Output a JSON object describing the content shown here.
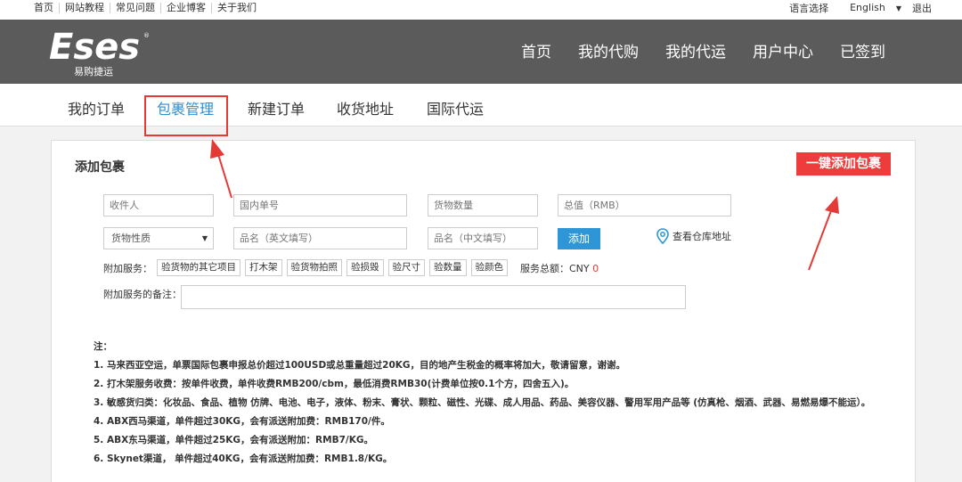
{
  "topbar": {
    "links": [
      "首页",
      "网站教程",
      "常见问题",
      "企业博客",
      "关于我们"
    ],
    "language_label": "语言选择",
    "language_value": "English",
    "logout": "退出"
  },
  "header": {
    "logo_text": "Eses",
    "logo_tagline": "易购捷运",
    "nav": [
      "首页",
      "我的代购",
      "我的代运",
      "用户中心",
      "已签到"
    ]
  },
  "tabs": [
    "我的订单",
    "包裹管理",
    "新建订单",
    "收货地址",
    "国际代运"
  ],
  "panel": {
    "title": "添加包裹",
    "quick_add": "一键添加包裹",
    "fields": {
      "recipient": "收件人",
      "domestic_no": "国内单号",
      "quantity": "货物数量",
      "value": "总值（RMB）",
      "nature": "货物性质",
      "name_en": "品名（英文填写）",
      "name_cn": "品名（中文填写）"
    },
    "add_button": "添加",
    "warehouse_link": "查看仓库地址",
    "services_label": "附加服务：",
    "services": [
      "验货物的其它项目",
      "打木架",
      "验货物拍照",
      "验损毁",
      "验尺寸",
      "验数量",
      "验颜色"
    ],
    "total_label": "服务总额：CNY",
    "total_value": "0",
    "remark_label": "附加服务的备注："
  },
  "notes": {
    "title": "注：",
    "items": [
      "1. 马来西亚空运，单票国际包裹申报总价超过100USD或总重量超过20KG，目的地产生税金的概率将加大，敬请留意，谢谢。",
      "2. 打木架服务收费：按单件收费，单件收费RMB200/cbm，最低消费RMB30(计费单位按0.1个方，四舍五入)。",
      "3. 敏感货归类：化妆品、食品、植物 仿牌、电池、电子，液体、粉末、膏状、颗粒、磁性、光碟、成人用品、药品、美容仪器、警用军用产品等 (仿真枪、烟酒、武器、易燃易爆不能运）。",
      "4. ABX西马渠道，单件超过30KG，会有派送附加费：RMB170/件。",
      "5. ABX东马渠道，单件超过25KG，会有派送附加：RMB7/KG。",
      "6. Skynet渠道， 单件超过40KG，会有派送附加费：RMB1.8/KG。"
    ]
  },
  "colors": {
    "header_bg": "#5b5b5b",
    "accent_blue": "#2e8fd0",
    "accent_red": "#ee3b3b"
  }
}
